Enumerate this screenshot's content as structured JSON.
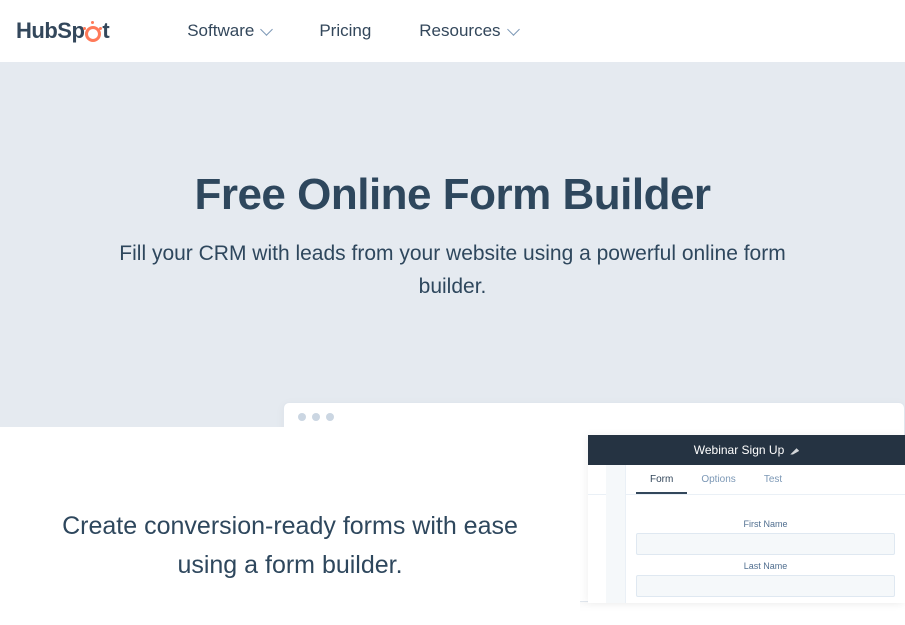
{
  "nav": {
    "logo": "HubSpot",
    "items": [
      {
        "label": "Software",
        "dropdown": true
      },
      {
        "label": "Pricing",
        "dropdown": false
      },
      {
        "label": "Resources",
        "dropdown": true
      }
    ]
  },
  "hero": {
    "title": "Free Online Form Builder",
    "subtitle": "Fill your CRM with leads from your website using a powerful online form builder."
  },
  "lower": {
    "heading": "Create conversion-ready forms with ease using a form builder."
  },
  "embed": {
    "title": "Webinar Sign Up",
    "tabs": [
      {
        "label": "Form",
        "active": true
      },
      {
        "label": "Options",
        "active": false
      },
      {
        "label": "Test",
        "active": false
      }
    ],
    "fields": [
      {
        "label": "First Name"
      },
      {
        "label": "Last Name"
      }
    ]
  }
}
